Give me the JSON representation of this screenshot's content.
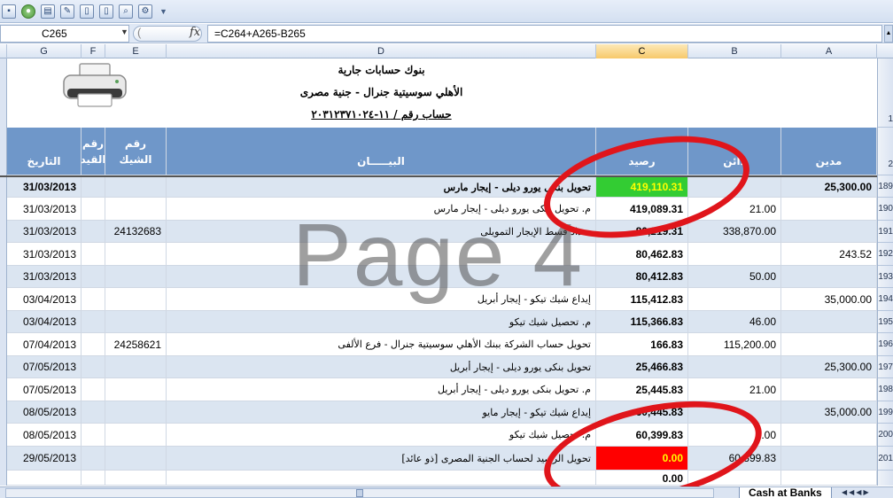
{
  "toolbar": {
    "icons": [
      "save-icon",
      "print-icon",
      "paste-icon",
      "format-painter-icon",
      "document-icon",
      "document-icon",
      "zoom-icon",
      "settings-icon"
    ]
  },
  "formula_bar": {
    "cell_ref": "C265",
    "fx": "fx",
    "formula": "=C264+A265-B265"
  },
  "columns": [
    "G",
    "F",
    "E",
    "D",
    "C",
    "B",
    "A"
  ],
  "title": {
    "line1": "بنوك حسابات جارية",
    "line2": "الأهلي سوسيتية جنرال - جنية مصرى",
    "line3": "حساب رقم / ١١-٢٠٣١٢٣٧١٠٢٤"
  },
  "table_header": {
    "date": "التاريخ",
    "entry_no": "رقم القيد",
    "cheque_no": "رقم الشيك",
    "description": "البيـــــان",
    "balance": "رصيد",
    "creditor": "دائن",
    "debtor": "مدين"
  },
  "row_numbers": [
    "1",
    "2",
    "189",
    "190",
    "191",
    "192",
    "193",
    "194",
    "195",
    "196",
    "197",
    "198",
    "199",
    "200",
    "201"
  ],
  "rows": [
    {
      "date": "31/03/2013",
      "cheque": "",
      "desc": "تحويل بنكى يورو ديلى - إيجار مارس",
      "balance": "419,110.31",
      "credit": "",
      "debit": "25,300.00"
    },
    {
      "date": "31/03/2013",
      "cheque": "",
      "desc": "م. تحويل بنكى يورو ديلى - إيجار مارس",
      "balance": "419,089.31",
      "credit": "21.00",
      "debit": ""
    },
    {
      "date": "31/03/2013",
      "cheque": "24132683",
      "desc": "سداد قسط الإيجار التمويلى",
      "balance": "80,219.31",
      "credit": "338,870.00",
      "debit": ""
    },
    {
      "date": "31/03/2013",
      "cheque": "",
      "desc": "",
      "balance": "80,462.83",
      "credit": "",
      "debit": "243.52"
    },
    {
      "date": "31/03/2013",
      "cheque": "",
      "desc": "",
      "balance": "80,412.83",
      "credit": "50.00",
      "debit": ""
    },
    {
      "date": "03/04/2013",
      "cheque": "",
      "desc": "إيداع شيك تيكو - إيجار أبريل",
      "balance": "115,412.83",
      "credit": "",
      "debit": "35,000.00"
    },
    {
      "date": "03/04/2013",
      "cheque": "",
      "desc": "م. تحصيل شيك تيكو",
      "balance": "115,366.83",
      "credit": "46.00",
      "debit": ""
    },
    {
      "date": "07/04/2013",
      "cheque": "24258621",
      "desc": "تحويل حساب الشركة ببنك الأهلي سوسيتية جنرال - فرع الألفى",
      "balance": "166.83",
      "credit": "115,200.00",
      "debit": ""
    },
    {
      "date": "07/05/2013",
      "cheque": "",
      "desc": "تحويل بنكى يورو ديلى - إيجار أبريل",
      "balance": "25,466.83",
      "credit": "",
      "debit": "25,300.00"
    },
    {
      "date": "07/05/2013",
      "cheque": "",
      "desc": "م. تحويل بنكى يورو ديلى - إيجار أبريل",
      "balance": "25,445.83",
      "credit": "21.00",
      "debit": ""
    },
    {
      "date": "08/05/2013",
      "cheque": "",
      "desc": "إيداع شيك تيكو - إيجار مايو",
      "balance": "60,445.83",
      "credit": "",
      "debit": "35,000.00"
    },
    {
      "date": "08/05/2013",
      "cheque": "",
      "desc": "م. تحصيل شيك تيكو",
      "balance": "60,399.83",
      "credit": ".00",
      "debit": ""
    },
    {
      "date": "29/05/2013",
      "cheque": "",
      "desc": "تحويل الرصيد لحساب الجنية المصرى [ذو عائد]",
      "balance": "0.00",
      "credit": "60,399.83",
      "debit": ""
    },
    {
      "date": "",
      "cheque": "",
      "desc": "",
      "balance": "0.00",
      "credit": "",
      "debit": ""
    }
  ],
  "watermark": "Page 4",
  "sheet_tab": "Cash at Banks",
  "colors": {
    "header_blue": "#6f97c9",
    "row_light": "#dbe5f1",
    "highlight_green": "#33cc33",
    "highlight_red": "#ff0000",
    "balance_highlight_text": "#ffff00",
    "ring_red": "#e0151b"
  }
}
